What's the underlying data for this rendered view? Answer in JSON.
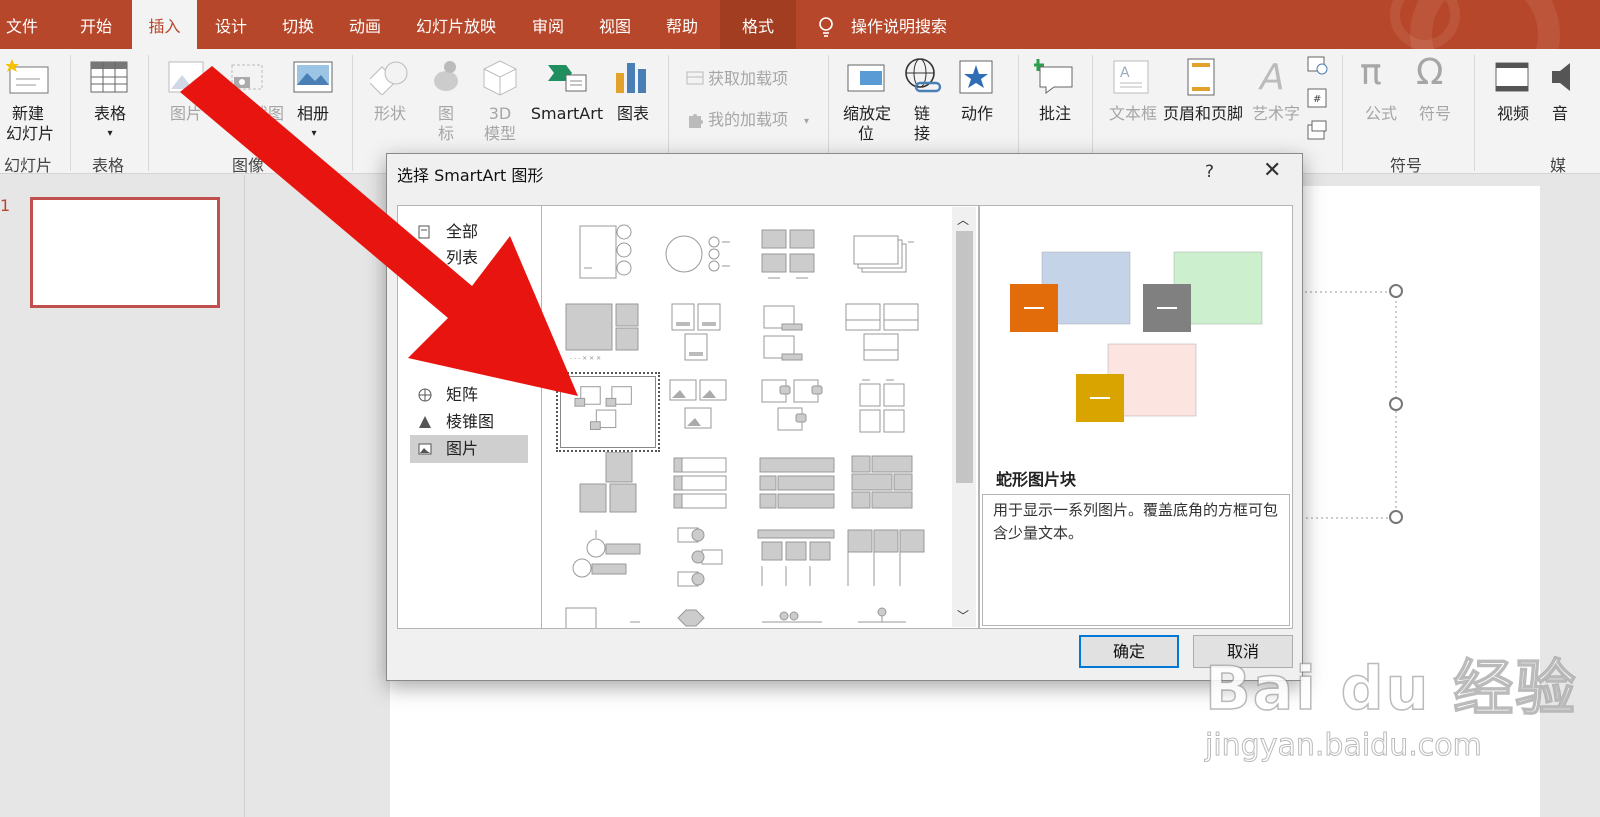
{
  "tabs": [
    {
      "label": "文件"
    },
    {
      "label": "开始"
    },
    {
      "label": "插入"
    },
    {
      "label": "设计"
    },
    {
      "label": "切换"
    },
    {
      "label": "动画"
    },
    {
      "label": "幻灯片放映"
    },
    {
      "label": "审阅"
    },
    {
      "label": "视图"
    },
    {
      "label": "帮助"
    },
    {
      "label": "格式"
    }
  ],
  "search_label": "操作说明搜索",
  "ribbon": {
    "new_slide": [
      "新建",
      "幻灯片"
    ],
    "table": "表格",
    "picture": "图片",
    "screenshot_partial": "截图",
    "album": "相册",
    "shapes": "形状",
    "icons": [
      "图",
      "标"
    ],
    "model3d": [
      "3D",
      "模型"
    ],
    "smartart": "SmartArt",
    "chart": "图表",
    "get_addins": "获取加载项",
    "my_addins": "我的加载项",
    "zoom": [
      "缩放定",
      "位"
    ],
    "link": [
      "链",
      "接"
    ],
    "action": "动作",
    "comment": "批注",
    "textbox": "文本框",
    "header_footer": "页眉和页脚",
    "wordart": "艺术字",
    "equation": "公式",
    "symbol": "符号",
    "video": "视频",
    "audio_partial": "音",
    "group_labels": {
      "slides": "幻灯片",
      "tables": "表格",
      "images": "图像",
      "symbols": "符号",
      "media_partial": "媒"
    }
  },
  "slide_thumb": {
    "number": "1"
  },
  "dialog": {
    "title": "选择 SmartArt 图形",
    "help": "?",
    "close": "✕",
    "categories": [
      {
        "label": "全部"
      },
      {
        "label": "列表"
      },
      {
        "label": "矩阵"
      },
      {
        "label": "棱锥图"
      },
      {
        "label": "图片"
      }
    ],
    "preview": {
      "title": "蛇形图片块",
      "description": "用于显示一系列图片。覆盖底角的方框可包含少量文本。",
      "colors": [
        "#c5d3e8",
        "#ccf0cd",
        "#fce4e0"
      ],
      "tag_colors": [
        "#e36c0a",
        "#808080",
        "#d9a400"
      ]
    },
    "ok": "确定",
    "cancel": "取消"
  },
  "watermark": {
    "main": "Bai du 经验",
    "url": "jingyan.baidu.com"
  },
  "arrow_color": "#e8140f"
}
